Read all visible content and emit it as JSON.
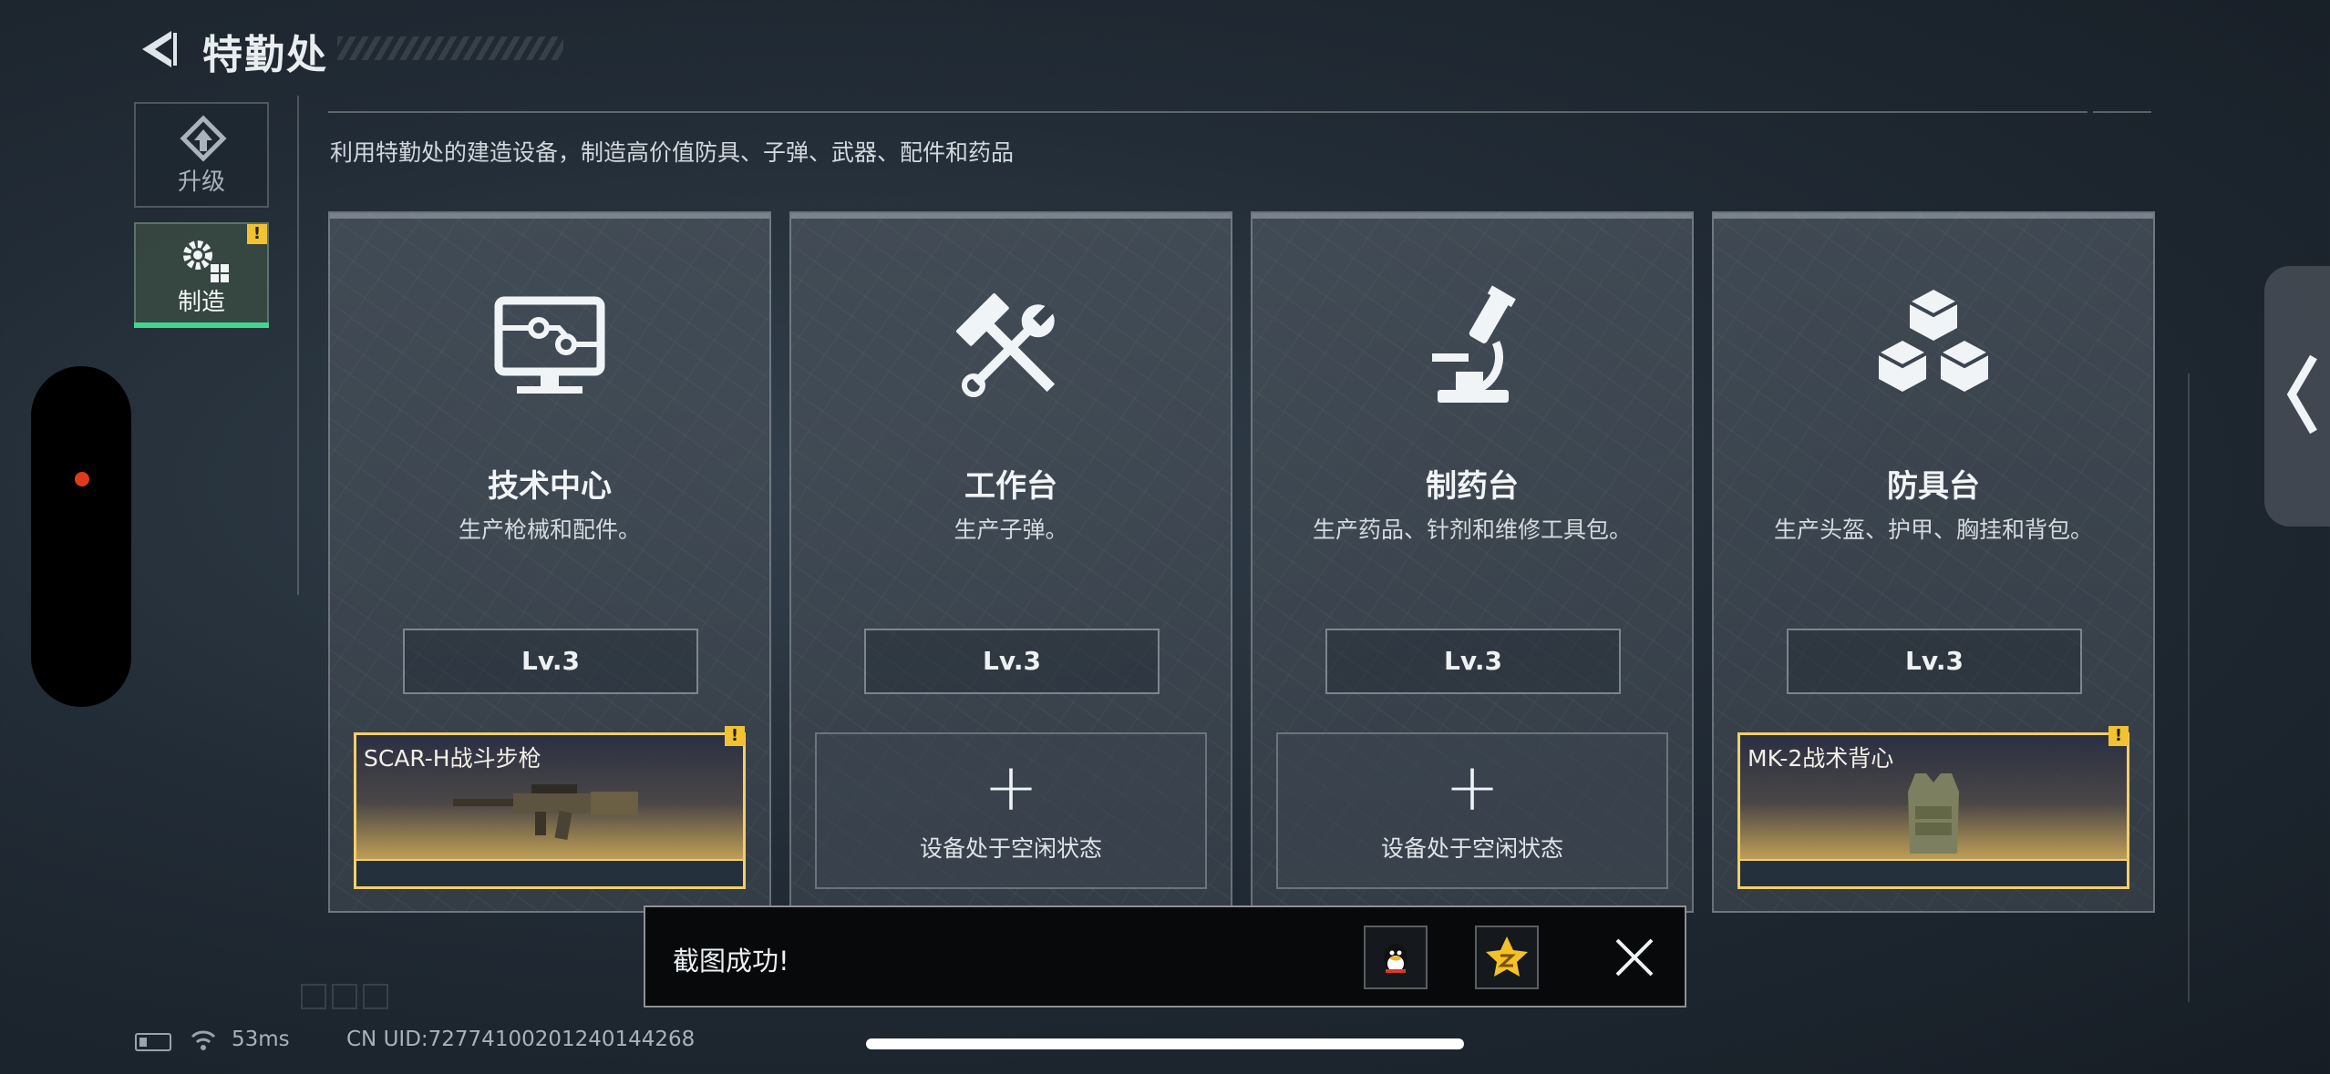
{
  "header": {
    "title": "特勤处",
    "description": "利用特勤处的建造设备，制造高价值防具、子弹、武器、配件和药品"
  },
  "side_tabs": [
    {
      "label": "升级",
      "icon": "upgrade-icon",
      "active": false
    },
    {
      "label": "制造",
      "icon": "gears-icon",
      "active": true,
      "alert": "!"
    }
  ],
  "stations": [
    {
      "name": "技术中心",
      "desc": "生产枪械和配件。",
      "level": "Lv.3",
      "icon": "monitor-icon",
      "slot": {
        "state": "item",
        "item_name": "SCAR-H战斗步枪",
        "alert": "!",
        "icon": "rifle-icon"
      }
    },
    {
      "name": "工作台",
      "desc": "生产子弹。",
      "level": "Lv.3",
      "icon": "hammer-wrench-icon",
      "slot": {
        "state": "idle",
        "plus": "+",
        "idle_text": "设备处于空闲状态"
      }
    },
    {
      "name": "制药台",
      "desc": "生产药品、针剂和维修工具包。",
      "level": "Lv.3",
      "icon": "microscope-icon",
      "slot": {
        "state": "idle",
        "plus": "+",
        "idle_text": "设备处于空闲状态"
      }
    },
    {
      "name": "防具台",
      "desc": "生产头盔、护甲、胸挂和背包。",
      "level": "Lv.3",
      "icon": "cubes-icon",
      "slot": {
        "state": "item",
        "item_name": "MK-2战术背心",
        "alert": "!",
        "icon": "vest-icon"
      }
    }
  ],
  "toast": {
    "text": "截图成功!",
    "share_buttons": [
      "qq-icon",
      "qzone-icon"
    ],
    "close_icon": "close-icon"
  },
  "status_bar": {
    "ping": "53ms",
    "uid": "CN UID:72774100201240144268"
  },
  "colors": {
    "accent_green": "#3fd88e",
    "gold": "#f2cf6a",
    "alert_yellow": "#f1c232",
    "record_red": "#e03a1c"
  }
}
